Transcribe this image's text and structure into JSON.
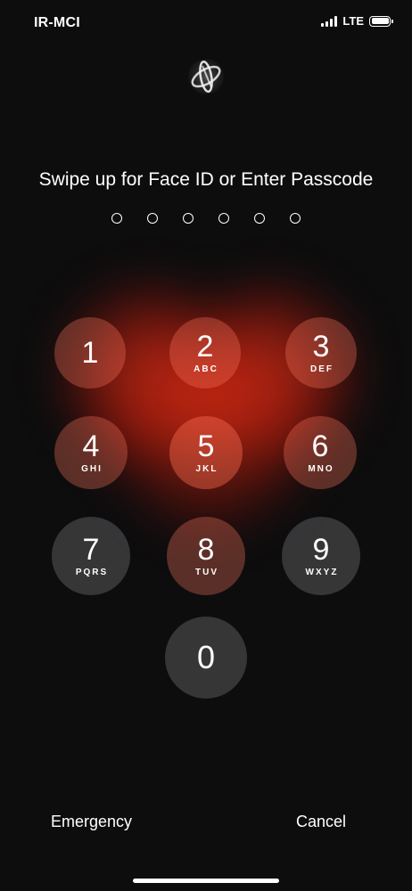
{
  "status_bar": {
    "carrier": "IR-MCI",
    "network": "LTE",
    "icons": [
      "signal-icon",
      "battery-icon"
    ]
  },
  "lock": {
    "icon": "faceid-icon",
    "prompt": "Swipe up for Face ID or Enter Passcode",
    "passcode_length": 6,
    "entered_digits": 0
  },
  "keypad": {
    "keys": [
      {
        "num": "1",
        "letters": ""
      },
      {
        "num": "2",
        "letters": "ABC"
      },
      {
        "num": "3",
        "letters": "DEF"
      },
      {
        "num": "4",
        "letters": "GHI"
      },
      {
        "num": "5",
        "letters": "JKL"
      },
      {
        "num": "6",
        "letters": "MNO"
      },
      {
        "num": "7",
        "letters": "PQRS"
      },
      {
        "num": "8",
        "letters": "TUV"
      },
      {
        "num": "9",
        "letters": "WXYZ"
      },
      {
        "num": "0",
        "letters": ""
      }
    ]
  },
  "actions": {
    "emergency": "Emergency",
    "cancel": "Cancel"
  },
  "colors": {
    "background": "#0d0d0e",
    "glow": "#e0321a"
  }
}
